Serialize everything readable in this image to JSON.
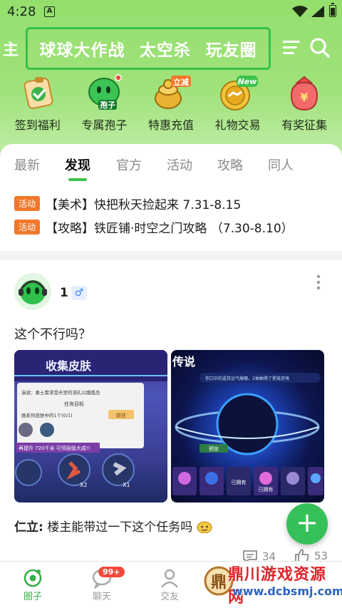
{
  "status_bar": {
    "time": "4:28",
    "app_icon": "A"
  },
  "channels": {
    "edge_partial": "主",
    "items": [
      "球球大作战",
      "太空杀",
      "玩友圈"
    ]
  },
  "header_icons": {
    "menu": "menu-icon",
    "search": "search-icon"
  },
  "shortcuts": [
    {
      "label": "签到福利",
      "icon": "checkin-icon"
    },
    {
      "label": "专属孢子",
      "icon": "spore-icon",
      "tag": "孢子"
    },
    {
      "label": "特惠充值",
      "icon": "recharge-icon",
      "tag": "立减"
    },
    {
      "label": "礼物交易",
      "icon": "gift-trade-icon",
      "tag": "New"
    },
    {
      "label": "有奖征集",
      "icon": "prize-icon"
    }
  ],
  "tabs": [
    "最新",
    "发现",
    "官方",
    "活动",
    "攻略",
    "同人"
  ],
  "active_tab": "发现",
  "announcements": [
    {
      "badge": "活动",
      "text": "【美术】快把秋天捡起来 7.31-8.15"
    },
    {
      "badge": "活动",
      "text": "【攻略】铁匠铺·时空之门攻略 （7.30-8.10）"
    }
  ],
  "post": {
    "username": "1",
    "gender": "♂",
    "text": "这个不行吗？",
    "image1": {
      "title": "收集皮肤",
      "subtitle": "演说：勇士需求受天罡的流礼以蹭孤岛",
      "task": "任务目标",
      "progress": "画系列皮肤中的1个(0/1)",
      "go": "前往",
      "boost": "再提升 720千米 可领层级大成!!",
      "x2": "X2",
      "x1": "X1"
    },
    "image2": {
      "title": "传说",
      "hint": "你口中的逼货运气爆棚，2抽抽得了星链逆境",
      "btn1": "预览",
      "owned": "已拥有",
      "owned2": "已拥有"
    },
    "reply_user": "仁立:",
    "reply_text": "楼主能带过一下这个任务吗",
    "comments": "34",
    "likes": "53"
  },
  "fab": "+",
  "bottom_nav": [
    {
      "label": "圈子",
      "icon": "circle-icon"
    },
    {
      "label": "聊天",
      "icon": "chat-icon",
      "badge": "99+"
    },
    {
      "label": "交友",
      "icon": "friends-icon"
    }
  ],
  "watermark": {
    "line1": "鼎川游戏资源网",
    "line2": "www.dcbsmj.com",
    "logo": "鼎"
  },
  "colors": {
    "header_green": "#9fe27a",
    "accent_green": "#3cc24b",
    "badge_orange": "#f1782a",
    "badge_red": "#f24b3a"
  }
}
